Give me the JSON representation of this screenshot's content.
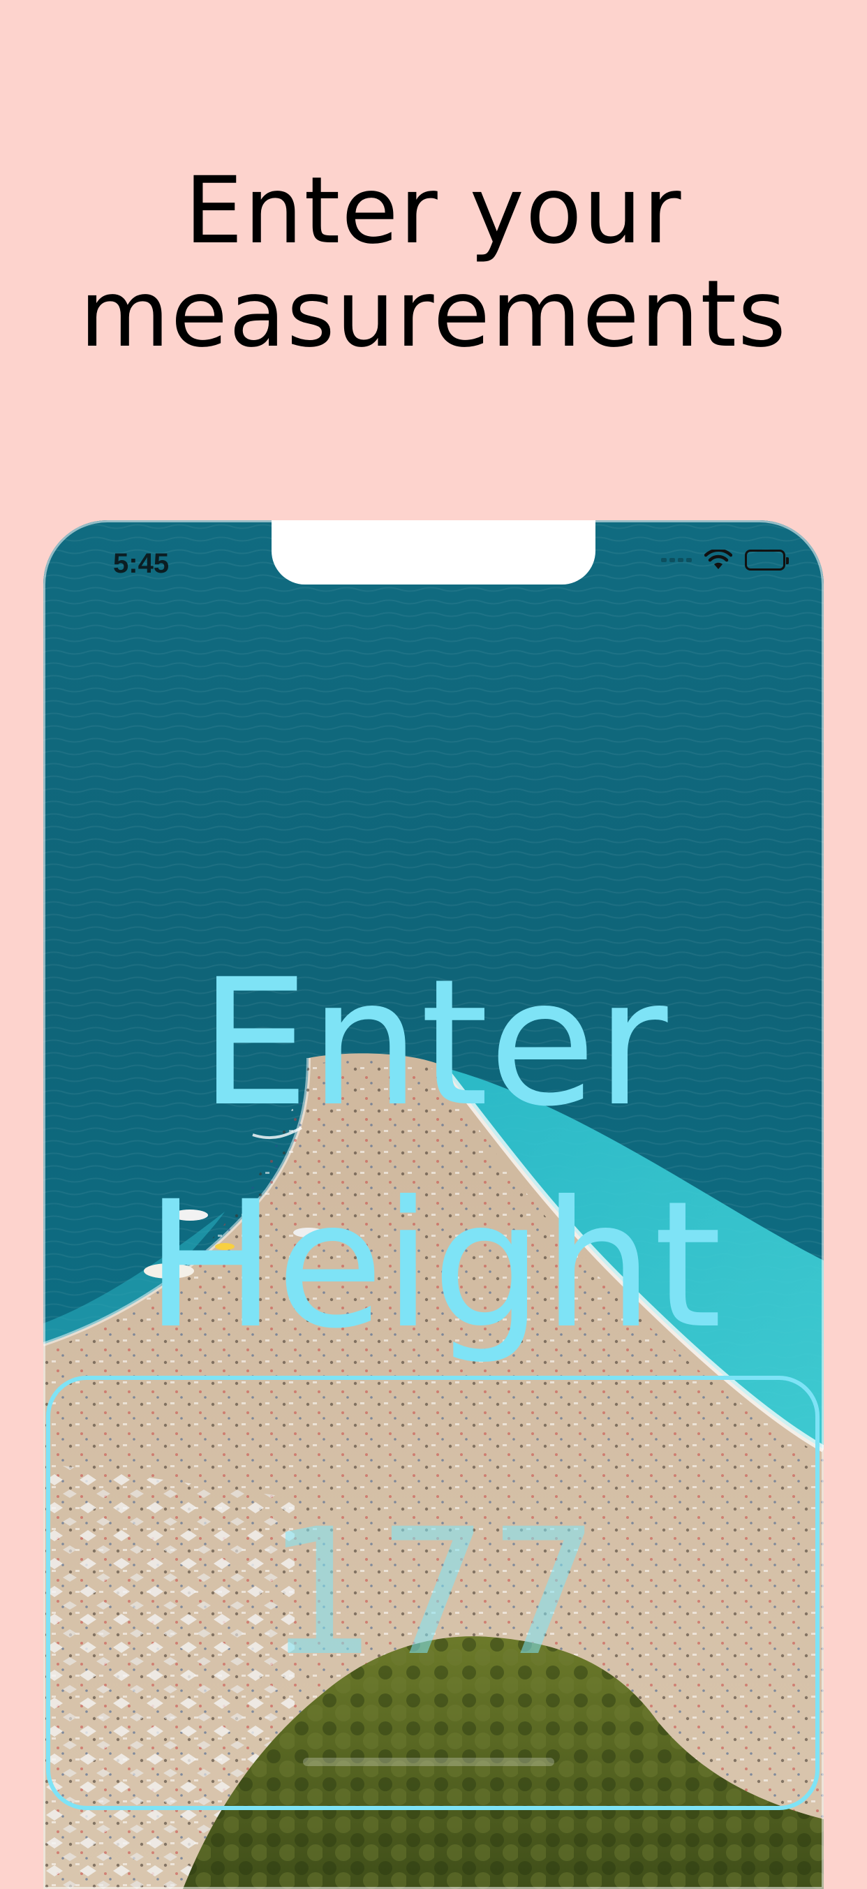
{
  "headline": {
    "line1": "Enter your",
    "line2": "measurements"
  },
  "status_bar": {
    "time": "5:45",
    "icons": [
      "cellular-signal-icon",
      "wifi-icon",
      "battery-icon"
    ]
  },
  "screen": {
    "prompt_line1": "Enter",
    "prompt_line2": "Height",
    "height_value": "177",
    "background_image": "aerial-beach-photo"
  },
  "colors": {
    "page_background": "#FDD3CD",
    "accent": "#7EE3F6",
    "headline_text": "#000000"
  }
}
